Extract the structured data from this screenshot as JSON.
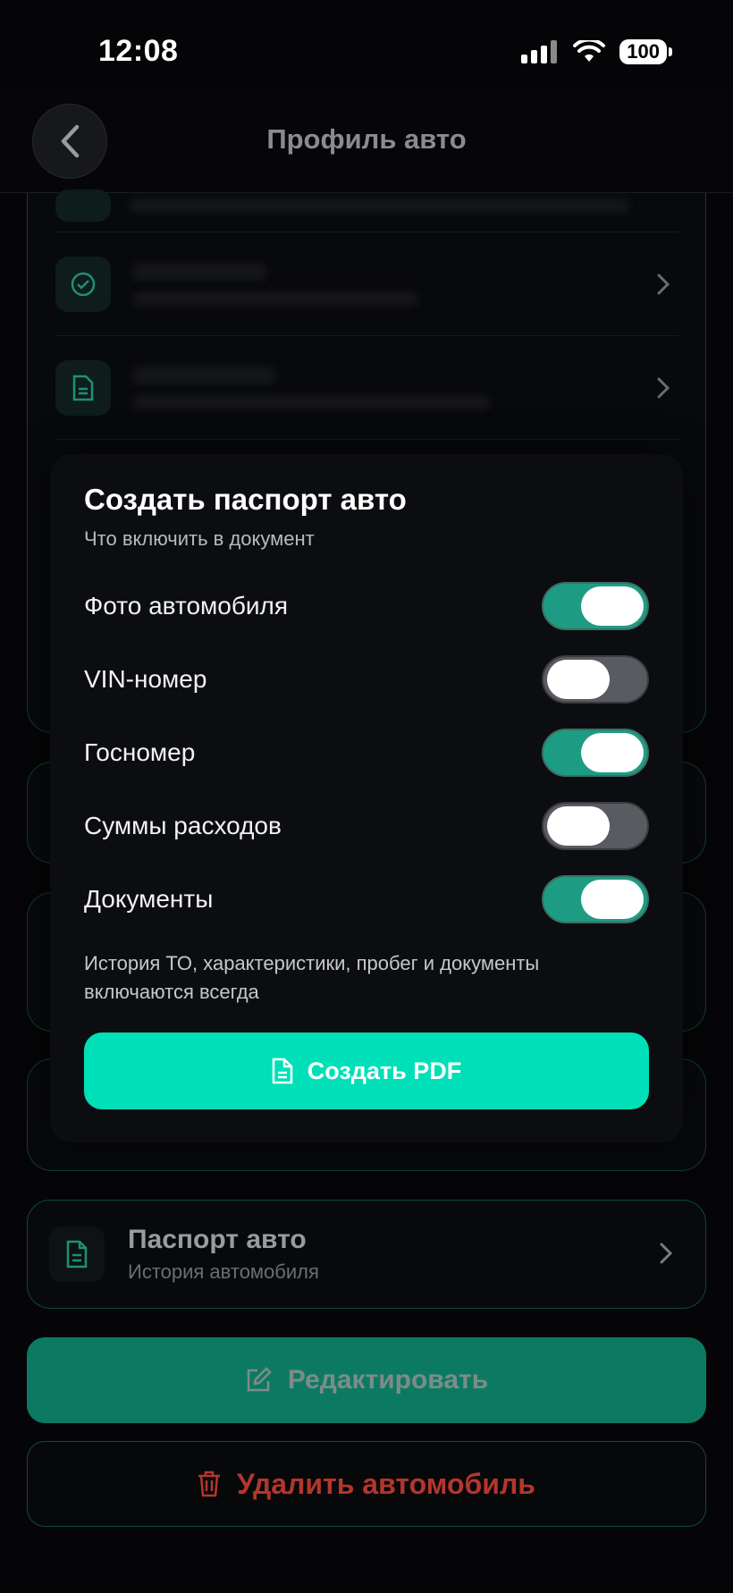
{
  "status_bar": {
    "time": "12:08",
    "battery": "100"
  },
  "header": {
    "title": "Профиль авто"
  },
  "passport_card": {
    "title": "Паспорт авто",
    "subtitle": "История автомобиля"
  },
  "actions": {
    "edit_label": "Редактировать",
    "delete_label": "Удалить автомобиль"
  },
  "sheet": {
    "title": "Создать паспорт авто",
    "subtitle": "Что включить в документ",
    "options": [
      {
        "label": "Фото автомобиля",
        "enabled": true
      },
      {
        "label": "VIN-номер",
        "enabled": false
      },
      {
        "label": "Госномер",
        "enabled": true
      },
      {
        "label": "Суммы расходов",
        "enabled": false
      },
      {
        "label": "Документы",
        "enabled": true
      }
    ],
    "note": "История ТО, характеристики, пробег и документы включаются всегда",
    "create_button": "Создать PDF"
  },
  "colors": {
    "accent": "#00e0b8",
    "toggle_on": "#1e9c83",
    "danger": "#b3362c"
  }
}
